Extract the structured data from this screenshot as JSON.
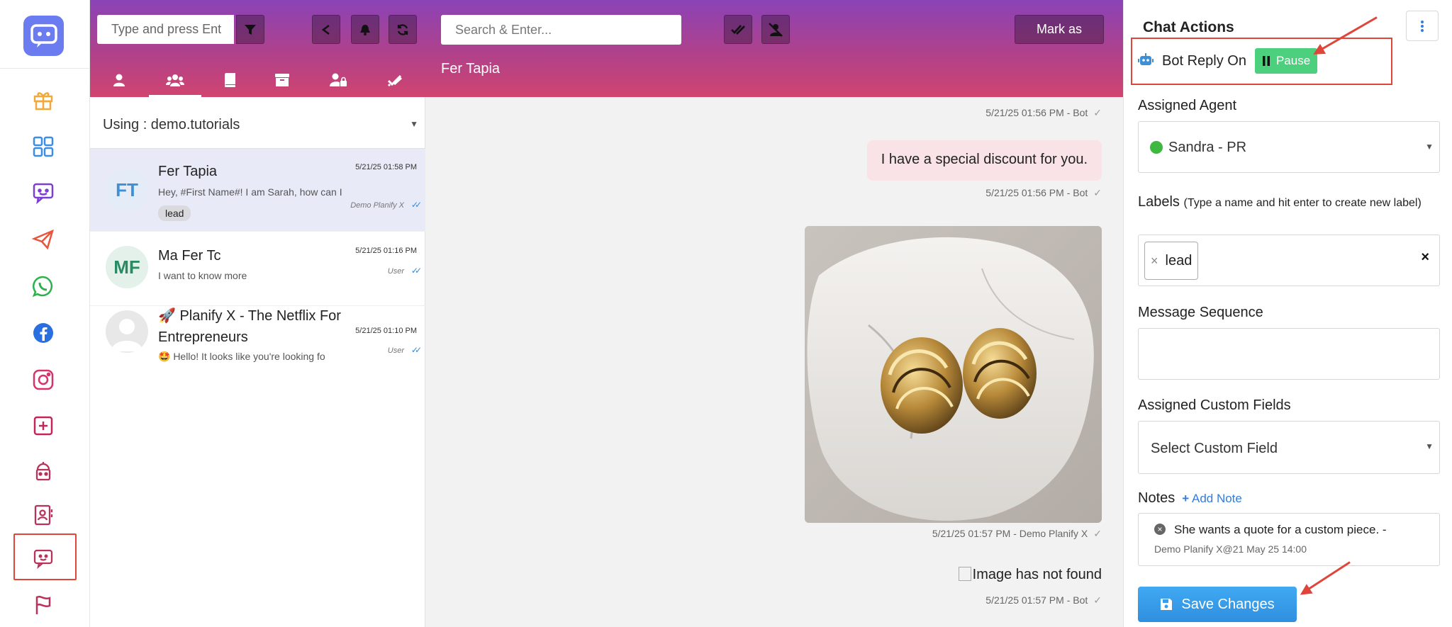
{
  "rail": {
    "icons": [
      "chatbot-logo-icon",
      "gift-icon",
      "grid-icon",
      "chat-bot-icon",
      "telegram-icon",
      "whatsapp-icon",
      "facebook-icon",
      "instagram-icon",
      "plus-square-icon",
      "robot-icon",
      "contacts-icon",
      "livechat-icon",
      "flag-icon"
    ]
  },
  "list": {
    "search_placeholder": "Type and press Ent",
    "using": "Using : demo.tutorials",
    "chats": [
      {
        "initials": "FT",
        "name": "Fer Tapia",
        "preview": "Hey, #First Name#! I am Sarah, how can I",
        "time": "5/21/25 01:58 PM",
        "by": "Demo Planify X",
        "badge": "lead"
      },
      {
        "initials": "MF",
        "name": "Ma Fer Tc",
        "preview": "I want to know more",
        "time": "5/21/25 01:16 PM",
        "by": "User"
      },
      {
        "initials": "",
        "name_line1": "🚀 Planify X - The Netflix For",
        "name_line2": "Entrepreneurs",
        "preview": "🤩 Hello! It looks like you're looking fo",
        "time": "5/21/25 01:10 PM",
        "by": "User"
      }
    ]
  },
  "chat": {
    "search_placeholder": "Search & Enter...",
    "mark_as": "Mark as",
    "title": "Fer Tapia",
    "messages": {
      "stamp1": "5/21/25 01:56 PM - Bot",
      "text1": "I have a special discount for you.",
      "stamp2": "5/21/25 01:56 PM - Bot",
      "stamp3": "5/21/25 01:57 PM - Demo Planify X",
      "broken_image": "Image has not found",
      "stamp4": "5/21/25 01:57 PM - Bot"
    }
  },
  "actions": {
    "title": "Chat Actions",
    "bot_reply": "Bot Reply On",
    "pause": "Pause",
    "assigned_agent_label": "Assigned Agent",
    "assigned_agent": "Sandra - PR",
    "labels_label": "Labels",
    "labels_hint": "(Type a name and hit enter to create new label)",
    "label_tag": "lead",
    "sequence_label": "Message Sequence",
    "custom_fields_label": "Assigned Custom Fields",
    "custom_fields_placeholder": "Select Custom Field",
    "notes_label": "Notes",
    "add_note": "Add Note",
    "note_text": "She wants a quote for a custom piece. -",
    "note_meta": "Demo Planify X@21 May 25 14:00",
    "save": "Save Changes"
  },
  "colors": {
    "accent": "#2f8fe0",
    "header_top": "#8a43b6",
    "header_bottom": "#d0446f",
    "pause": "#4cd07d",
    "highlight": "#e0453a"
  }
}
